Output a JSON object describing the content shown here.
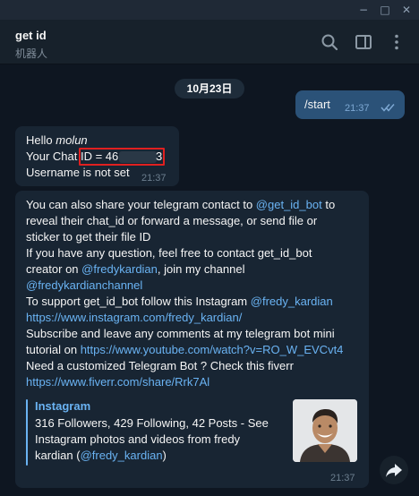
{
  "window": {
    "minimize_glyph": "−",
    "maximize_glyph": "□",
    "close_glyph": "✕"
  },
  "header": {
    "title": "get id",
    "subtitle": "机器人",
    "icons": [
      "search-icon",
      "sidebar-toggle-icon",
      "more-vert-icon"
    ]
  },
  "date_separator": "10月23日",
  "outgoing": {
    "text": "/start",
    "time": "21:37",
    "status": "read"
  },
  "message1": {
    "greeting_prefix": "Hello ",
    "name": "molun",
    "chat_id_prefix": "Your Chat ",
    "chat_id_label": "ID = 46",
    "chat_id_tail": "3",
    "username_line": "Username is not set",
    "time": "21:37"
  },
  "message2": {
    "time": "21:37",
    "l1_pre": "You can also share your telegram contact to ",
    "l1_link": "@get_id_bot",
    "l1_post": " to",
    "l2": "reveal their chat_id or forward a message, or send file or",
    "l3": "sticker to get their file ID",
    "l4": "If you have any question, feel free to contact get_id_bot",
    "l5_pre": "creator on ",
    "l5_link": "@fredykardian",
    "l5_post": ", join my channel",
    "l6_link": "@fredykardianchannel",
    "l7_pre": "To support get_id_bot follow this Instagram ",
    "l7_link": "@fredy_kardian",
    "l8_link": "https://www.instagram.com/fredy_kardian/",
    "l9": "Subscribe and leave any comments at my telegram bot mini",
    "l10_pre": "tutorial on ",
    "l10_link": "https://www.youtube.com/watch?v=RO_W_EVCvt4",
    "l11": "Need a customized Telegram Bot ? Check this fiverr",
    "l12_link": "https://www.fiverr.com/share/Rrk7Al",
    "preview": {
      "site": "Instagram",
      "d1": "316 Followers, 429 Following, 42 Posts - See",
      "d2": "Instagram photos and videos from fredy",
      "d3_pre": "kardian (",
      "d3_link": "@fredy_kardian",
      "d3_post": ")"
    }
  },
  "colors": {
    "background": "#0e1621",
    "bubble_in": "#182533",
    "bubble_out": "#2b5278",
    "link": "#6ab3f3",
    "highlight_box": "#e02020"
  }
}
